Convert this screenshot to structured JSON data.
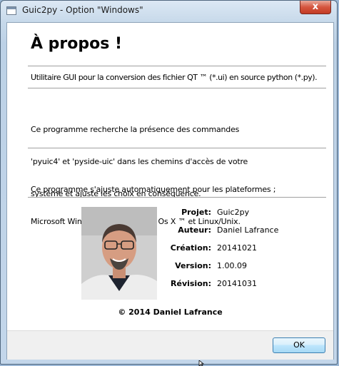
{
  "window": {
    "title": "Guic2py - Option \"Windows\"",
    "close_label": "x"
  },
  "about": {
    "heading": "À propos !",
    "paragraph1": "Utilitaire GUI pour la conversion des fichier QT ™ (*.ui) en source python (*.py).",
    "paragraph2_lines": [
      "Ce programme recherche la présence des commandes",
      "'pyuic4' et 'pyside-uic' dans les chemins d'accès de votre",
      "système et ajuste les choix en conséquence."
    ],
    "paragraph3_lines": [
      "Ce programme s'ajuste automatiquement pour les plateformes ;",
      "Microsoft Windows ™, Apple Mac Os X ™ et Linux/Unix."
    ]
  },
  "info": [
    {
      "key": "Projet:",
      "value": "Guic2py"
    },
    {
      "key": "Auteur:",
      "value": "Daniel Lafrance"
    },
    {
      "key": "Création:",
      "value": "20141021"
    },
    {
      "key": "Version:",
      "value": "1.00.09"
    },
    {
      "key": "Révision:",
      "value": "20141031"
    }
  ],
  "copyright": "© 2014 Daniel Lafrance",
  "buttons": {
    "ok_label": "OK"
  },
  "colors": {
    "window_frame": "#bcd1e6",
    "close_button": "#c9432d",
    "ok_border": "#3c7fb1"
  }
}
